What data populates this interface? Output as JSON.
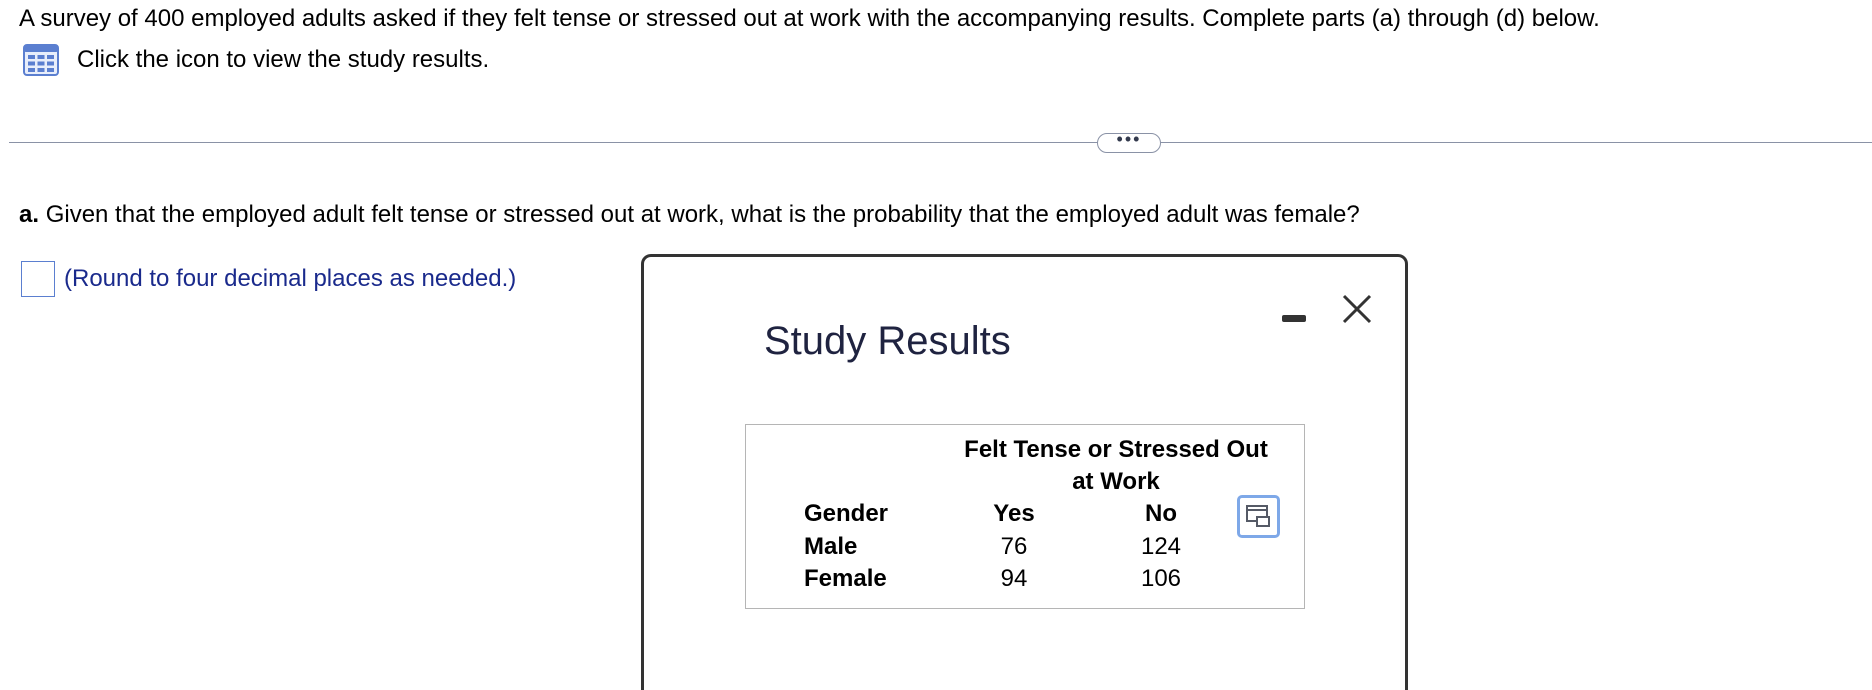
{
  "intro": {
    "text": "A survey of 400 employed adults asked if they felt tense or stressed out at work with the accompanying results. Complete parts (a) through (d) below.",
    "view_link_label": "Click the icon to view the study results."
  },
  "divider": {
    "more_label": "•••"
  },
  "question": {
    "part_label": "a.",
    "text": "Given that the employed adult felt tense or stressed out at work, what is the probability that the employed adult was female?"
  },
  "answer": {
    "value": "",
    "round_note": "(Round to four decimal places as needed.)"
  },
  "dialog": {
    "title": "Study Results",
    "table": {
      "group_header_line1": "Felt Tense or Stressed Out",
      "group_header_line2": "at Work",
      "row_header": "Gender",
      "col_yes": "Yes",
      "col_no": "No",
      "rows": [
        {
          "label": "Male",
          "yes": "76",
          "no": "124"
        },
        {
          "label": "Female",
          "yes": "94",
          "no": "106"
        }
      ]
    }
  },
  "colors": {
    "link_blue": "#1a2a8c",
    "icon_blue": "#5b7fd0",
    "copy_border": "#7ea8e8",
    "divider": "#8a92a6"
  },
  "icons": {
    "view": "table-grid-icon",
    "minimize": "minimize-icon",
    "close": "close-icon",
    "copy": "copy-icon"
  }
}
